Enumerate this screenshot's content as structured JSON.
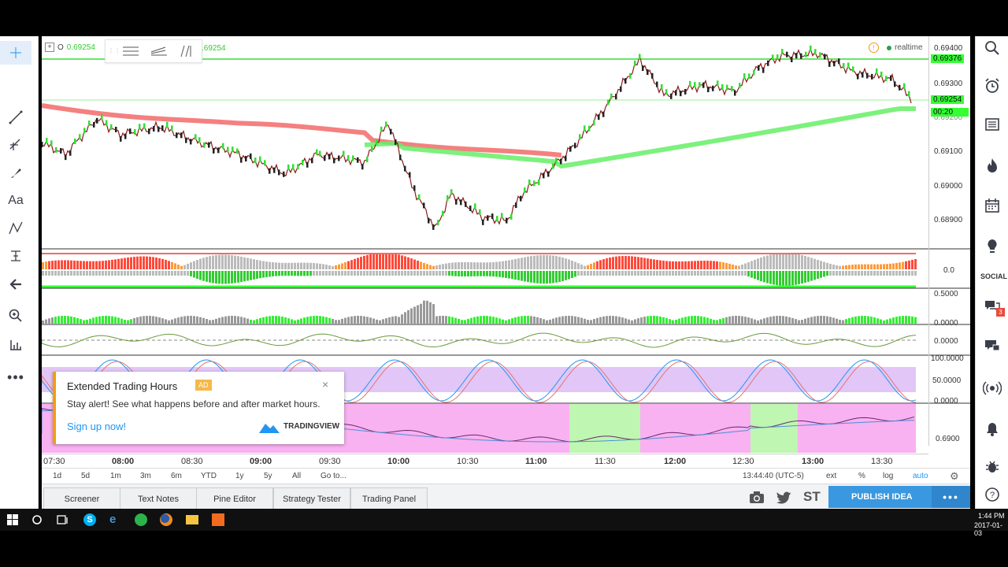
{
  "legend": {
    "open_label": "O",
    "open_value": "0.69254",
    "close_value": ".69254"
  },
  "realtime_label": "realtime",
  "price_axis": {
    "labels": [
      "0.69400",
      "0.69300",
      "0.69200",
      "0.69100",
      "0.69000",
      "0.68900"
    ],
    "high_tag": "0.69376",
    "current_tag": "0.69254",
    "countdown": "00:20"
  },
  "indicator_axes": {
    "p1": "0.0",
    "p2_top": "0.5000",
    "p2_bottom": "0.0000",
    "p3": "0.0000",
    "p4_top": "100.0000",
    "p4_mid": "50.0000",
    "p4_bottom": "0.0000",
    "p5": "0.6900"
  },
  "time_axis": [
    "07:30",
    "08:00",
    "08:30",
    "09:00",
    "09:30",
    "10:00",
    "10:30",
    "11:00",
    "11:30",
    "12:00",
    "12:30",
    "13:00",
    "13:30"
  ],
  "range_buttons": [
    "1d",
    "5d",
    "1m",
    "3m",
    "6m",
    "YTD",
    "1y",
    "5y",
    "All",
    "Go to..."
  ],
  "status": {
    "clock": "13:44:40 (UTC-5)",
    "ext": "ext",
    "pct": "%",
    "log": "log",
    "auto": "auto"
  },
  "bottom_tabs": [
    "Screener",
    "Text Notes",
    "Pine Editor",
    "Strategy Tester",
    "Trading Panel"
  ],
  "publish_label": "PUBLISH IDEA",
  "st_label": "ST",
  "sidebar": {
    "social_label": "SOCIAL",
    "chat_badge": "3"
  },
  "ad": {
    "title": "Extended Trading Hours",
    "badge": "AD",
    "body": "Stay alert! See what happens before and after market hours.",
    "link": "Sign up now!",
    "brand": "TRADINGVIEW"
  },
  "taskbar": {
    "time": "1:44 PM",
    "date": "2017-01-03"
  },
  "colors": {
    "up": "#33ff33",
    "red_ma": "#f26a6a",
    "green_ma": "#66ee66",
    "accent_blue": "#2196f3",
    "publish": "#3a98e0"
  }
}
